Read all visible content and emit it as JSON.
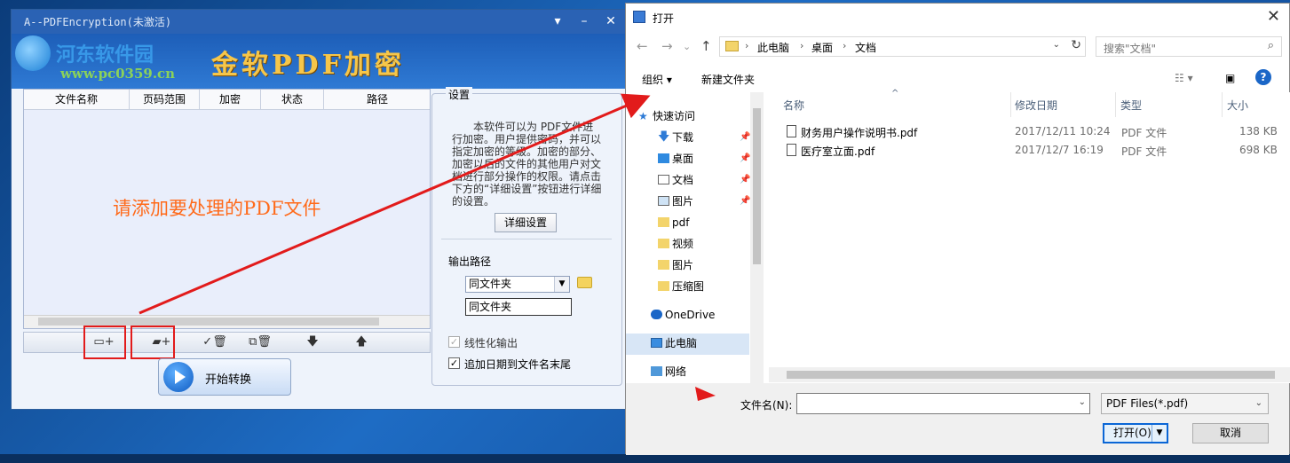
{
  "app": {
    "title": "A--PDFEncryption(未激活)",
    "watermark": "河东软件园",
    "watermark_url": "www.pc0359.cn",
    "banner": "金软PDF加密",
    "table_headers": [
      "文件名称",
      "页码范围",
      "加密",
      "状态",
      "路径"
    ],
    "hint": "请添加要处理的PDF文件",
    "toolbar_icons": [
      "add-file-icon",
      "add-folder-icon",
      "check-delete-icon",
      "copy-delete-icon",
      "move-down-icon",
      "move-up-icon"
    ],
    "start_button": "开始转换",
    "settings": {
      "title": "设置",
      "description": "本软件可以为 PDF文件进行加密。用户提供密码，并可以指定加密的等级。加密的部分、加密以后的文件的其他用户对文档进行部分操作的权限。请点击下方的“详细设置”按钮进行详细的设置。",
      "detail_button": "详细设置",
      "output_label": "输出路径",
      "output_combo": "同文件夹",
      "output_field": "同文件夹",
      "linearize_label": "线性化输出",
      "linearize_checked": true,
      "append_date_label": "追加日期到文件名末尾",
      "append_date_checked": true
    }
  },
  "dialog": {
    "title": "打开",
    "breadcrumb": [
      "此电脑",
      "桌面",
      "文档"
    ],
    "search_placeholder": "搜索\"文档\"",
    "organize": "组织 ▾",
    "new_folder": "新建文件夹",
    "help": "?",
    "nav_items": [
      {
        "label": "快速访问",
        "icon": "star-icon",
        "pinned": false
      },
      {
        "label": "下载",
        "icon": "download-icon",
        "pinned": true
      },
      {
        "label": "桌面",
        "icon": "desktop-icon",
        "pinned": true
      },
      {
        "label": "文档",
        "icon": "document-icon",
        "pinned": true
      },
      {
        "label": "图片",
        "icon": "picture-icon",
        "pinned": true
      },
      {
        "label": "pdf",
        "icon": "folder-icon",
        "pinned": false
      },
      {
        "label": "视频",
        "icon": "folder-icon",
        "pinned": false
      },
      {
        "label": "图片",
        "icon": "folder-icon",
        "pinned": false
      },
      {
        "label": "压缩图",
        "icon": "folder-icon",
        "pinned": false
      },
      {
        "label": "OneDrive",
        "icon": "cloud-icon",
        "pinned": false
      },
      {
        "label": "此电脑",
        "icon": "computer-icon",
        "pinned": false
      },
      {
        "label": "网络",
        "icon": "network-icon",
        "pinned": false
      }
    ],
    "columns": [
      "名称",
      "修改日期",
      "类型",
      "大小"
    ],
    "files": [
      {
        "name": "财务用户操作说明书.pdf",
        "date": "2017/12/11 10:24",
        "type": "PDF 文件",
        "size": "138 KB"
      },
      {
        "name": "医疗室立面.pdf",
        "date": "2017/12/7 16:19",
        "type": "PDF 文件",
        "size": "698 KB"
      }
    ],
    "filename_label": "文件名(N):",
    "filename_value": "",
    "filter": "PDF Files(*.pdf)",
    "open_button": "打开(O)",
    "cancel_button": "取消"
  },
  "colors": {
    "annotation_red": "#e21b1b",
    "hint_orange": "#ff6a1a",
    "banner_gold": "#f6c64a"
  }
}
